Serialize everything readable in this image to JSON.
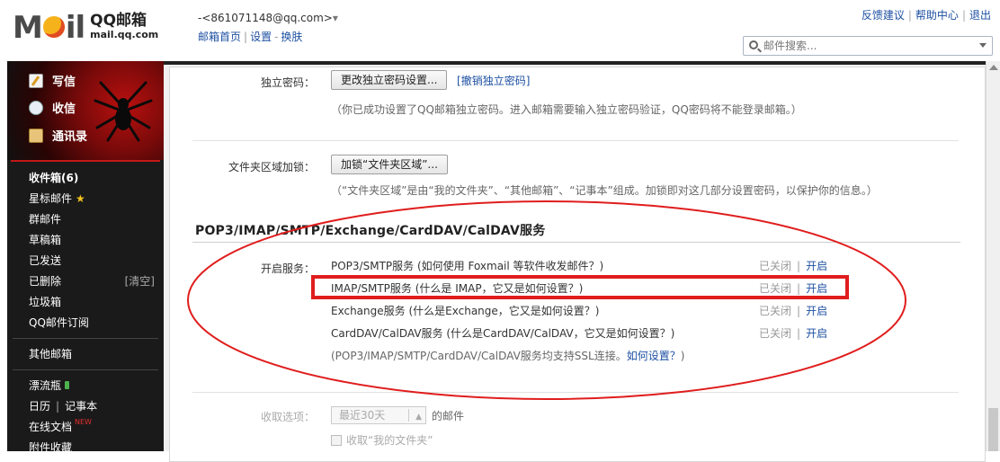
{
  "header": {
    "logo_text": "MOil",
    "brand_cn": "QQ邮箱",
    "brand_en": "mail.qq.com",
    "account_address": "-<861071148@qq.com>",
    "account_caret": "▾",
    "links": {
      "home": "邮箱首页",
      "settings": "设置",
      "skin": "换肤"
    },
    "top_right": {
      "feedback": "反馈建议",
      "help": "帮助中心",
      "logout": "退出"
    },
    "search": {
      "placeholder": "邮件搜索..."
    }
  },
  "left_nav": {
    "quick": {
      "compose": "写信",
      "receive": "收信",
      "contacts": "通讯录"
    },
    "items": {
      "inbox": "收件箱(6)",
      "starred": "星标邮件",
      "group": "群邮件",
      "drafts": "草稿箱",
      "sent": "已发送",
      "deleted": "已删除",
      "deleted_clear": "[清空]",
      "spam": "垃圾箱",
      "subscriptions": "QQ邮件订阅",
      "other_mailboxes": "其他邮箱",
      "drift_bottle": "漂流瓶",
      "calendar": "日历",
      "notes": "记事本",
      "online_docs": "在线文档",
      "online_docs_badge": "NEW",
      "attachments": "附件收藏"
    }
  },
  "settings": {
    "independent_password": {
      "label": "独立密码：",
      "button": "更改独立密码设置...",
      "revoke_link": "撤销独立密码",
      "hint": "（你已成功设置了QQ邮箱独立密码。进入邮箱需要输入独立密码验证，QQ密码将不能登录邮箱。）"
    },
    "folder_lock": {
      "label": "文件夹区域加锁：",
      "button": "加锁“文件夹区域”...",
      "hint": "（“文件夹区域”是由“我的文件夹”、“其他邮箱”、“记事本”组成。加锁即对这几部分设置密码，以保护你的信息。）"
    },
    "services": {
      "title": "POP3/IMAP/SMTP/Exchange/CardDAV/CalDAV服务",
      "label": "开启服务：",
      "rows": [
        {
          "name": "POP3/SMTP服务",
          "help": "(如何使用 Foxmail 等软件收发邮件？)",
          "status": "已关闭",
          "action": "开启"
        },
        {
          "name": "IMAP/SMTP服务",
          "help": "(什么是 IMAP，它又是如何设置？)",
          "status": "已关闭",
          "action": "开启"
        },
        {
          "name": "Exchange服务",
          "help": "(什么是Exchange，它又是如何设置？)",
          "status": "已关闭",
          "action": "开启"
        },
        {
          "name": "CardDAV/CalDAV服务",
          "help": "(什么是CardDAV/CalDAV，它又是如何设置？)",
          "status": "已关闭",
          "action": "开启"
        }
      ],
      "footnote_prefix": "(POP3/IMAP/SMTP/CardDAV/CalDAV服务均支持SSL连接。",
      "footnote_link": "如何设置？",
      "footnote_suffix": ")"
    },
    "receive_options": {
      "label": "收取选项：",
      "select_value": "最近30天",
      "suffix": "的邮件",
      "checkbox_label": "收取“我的文件夹”"
    }
  },
  "colors": {
    "annotation_red": "#e01d1d",
    "link_blue": "#1e50a2",
    "nav_bg": "#1a1a1a"
  }
}
